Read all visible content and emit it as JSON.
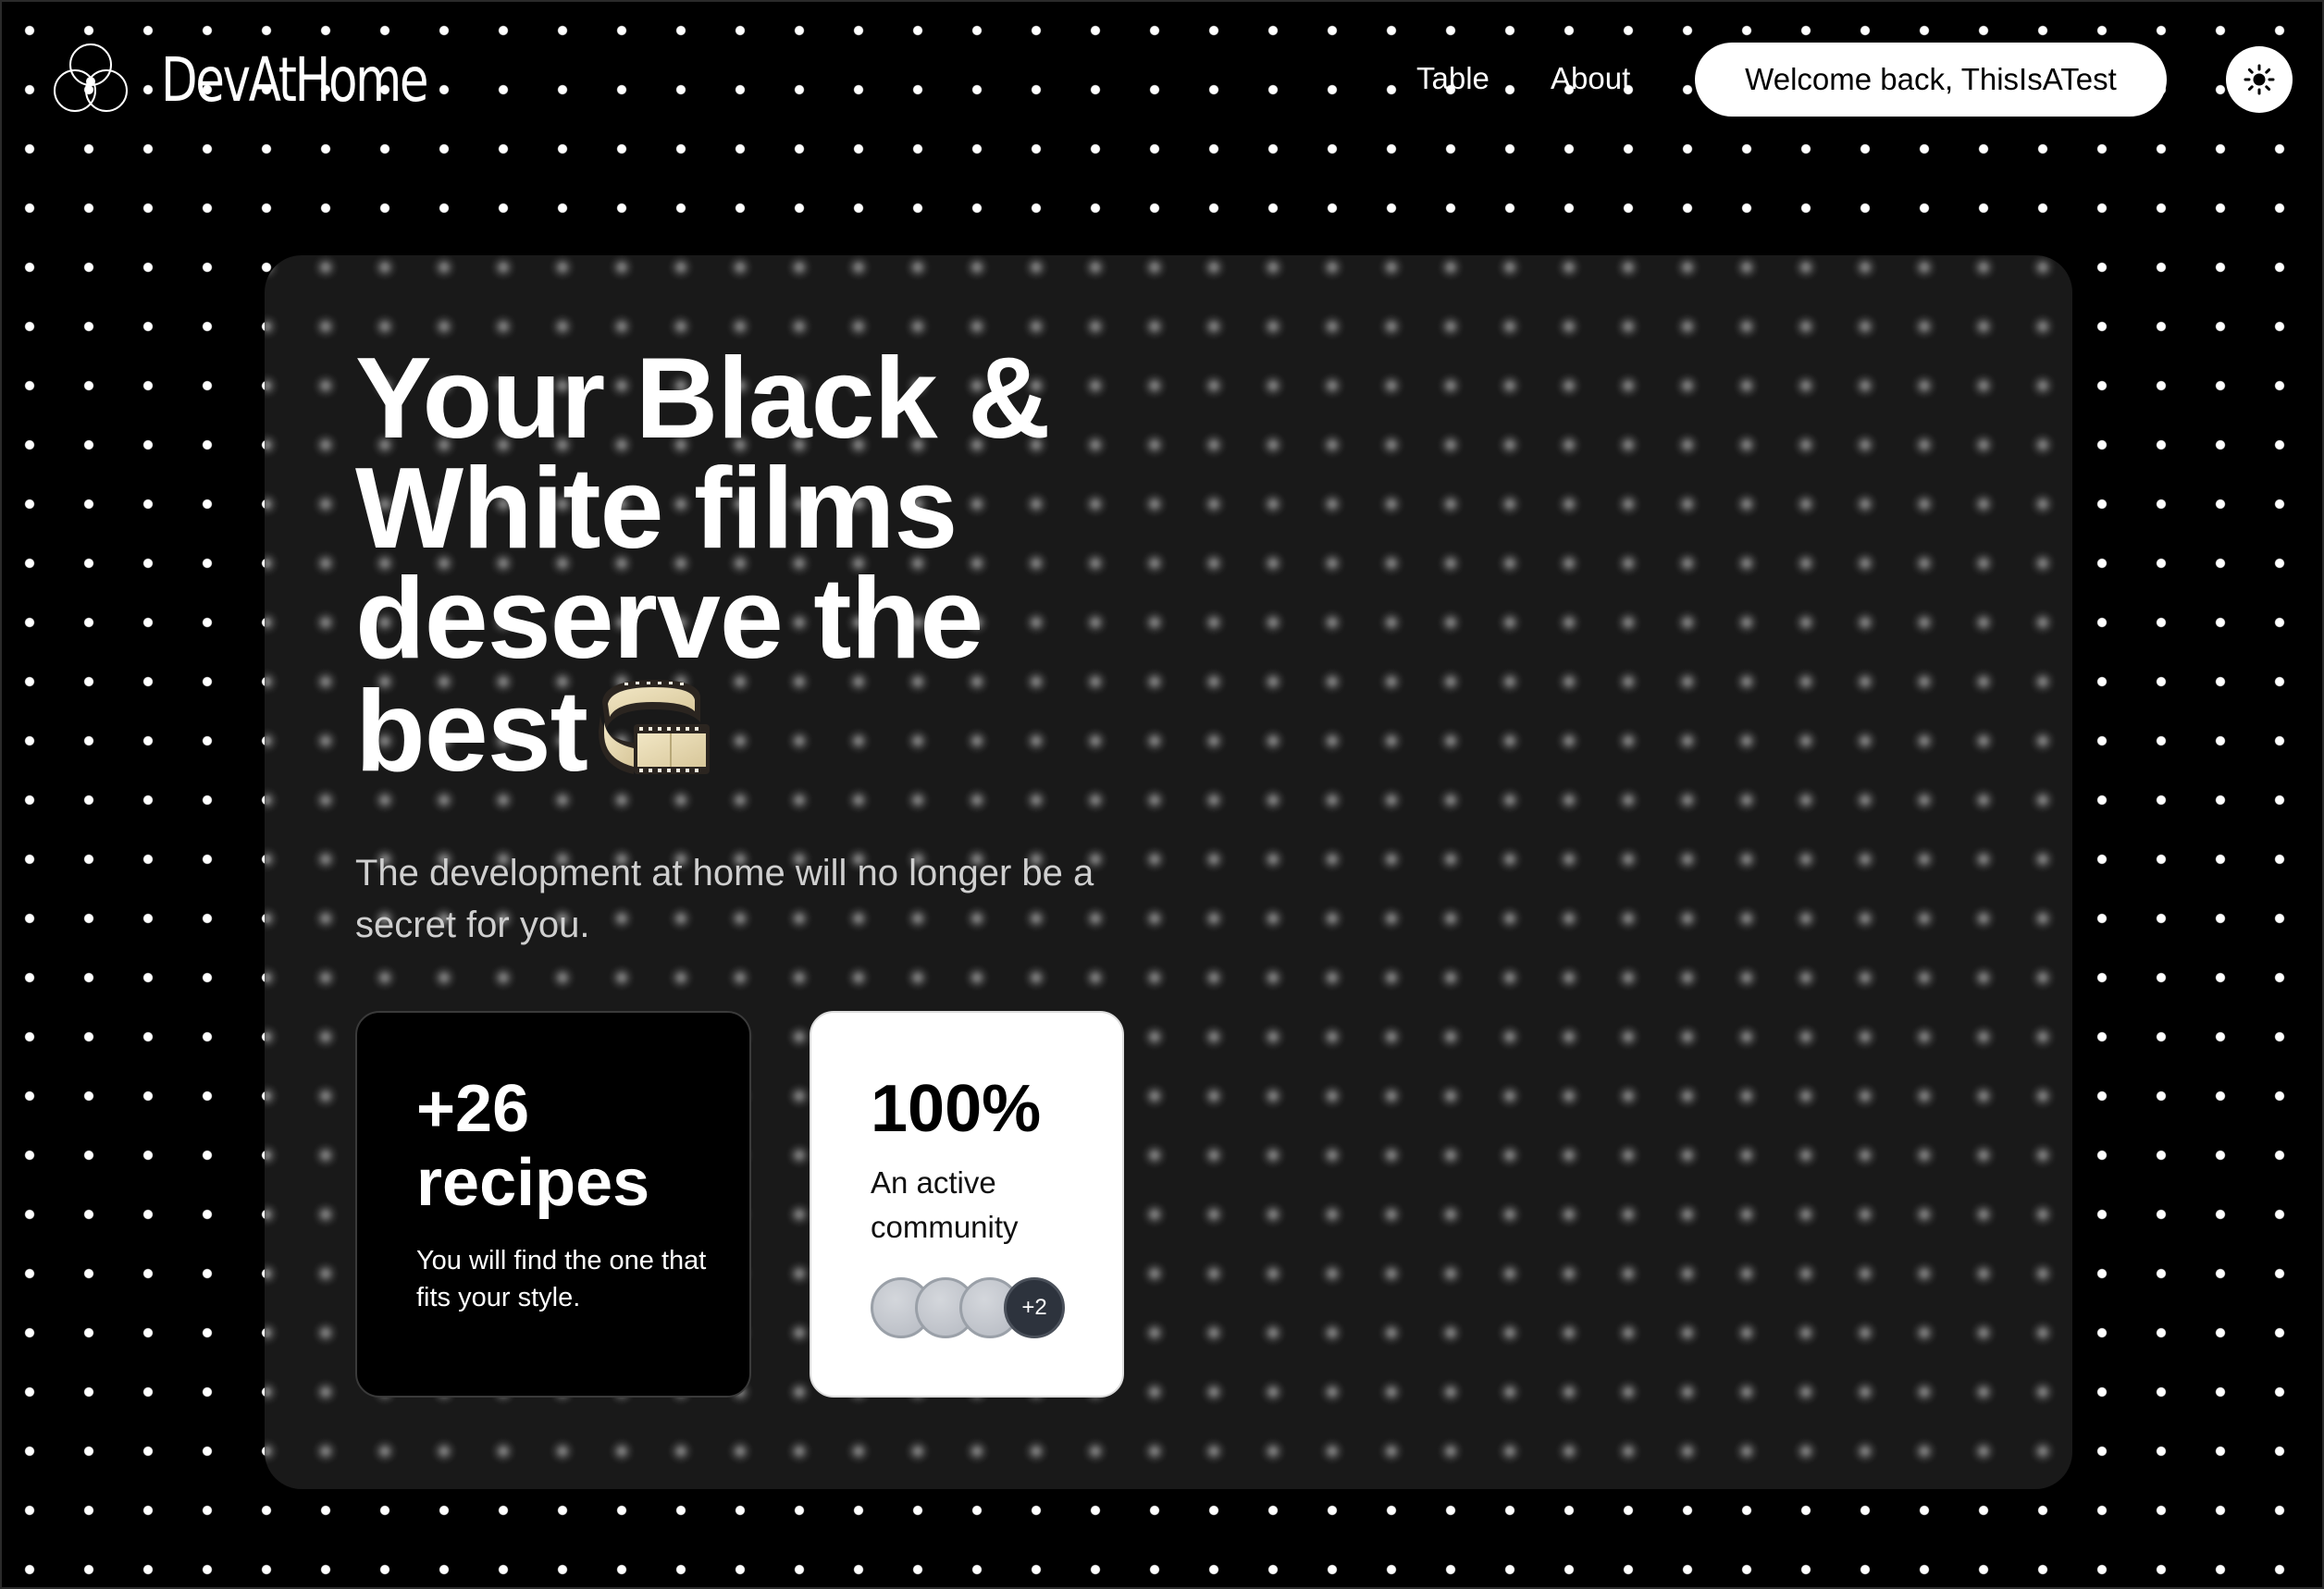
{
  "header": {
    "brand": "DevAtHome",
    "logo_icon": "overlapping-circles-logo",
    "nav": [
      {
        "label": "Table"
      },
      {
        "label": "About"
      }
    ],
    "welcome_label": "Welcome back, ThisIsATest",
    "theme_toggle_icon": "sun-icon"
  },
  "hero": {
    "title": "Your Black & White films deserve the best",
    "title_emoji": "film-strip-icon",
    "subtitle": "The development at home will no longer be a secret for you.",
    "stats": {
      "recipes": {
        "value": "+26 recipes",
        "caption": "You will find the one that fits your style."
      },
      "community": {
        "value": "100%",
        "caption": "An active community",
        "avatar_count": 3,
        "more_label": "+2"
      }
    }
  },
  "colors": {
    "background": "#000000",
    "dots": "#ffffff",
    "card": "#1e1e1e",
    "accent_light": "#ffffff"
  }
}
